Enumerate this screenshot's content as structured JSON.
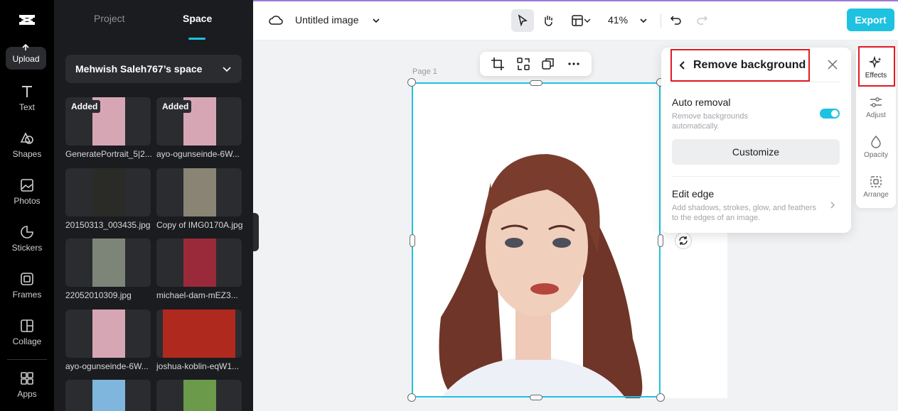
{
  "rail": {
    "items": [
      {
        "label": "Upload",
        "icon": "upload-icon"
      },
      {
        "label": "Text",
        "icon": "text-icon"
      },
      {
        "label": "Shapes",
        "icon": "shapes-icon"
      },
      {
        "label": "Photos",
        "icon": "photos-icon"
      },
      {
        "label": "Stickers",
        "icon": "stickers-icon"
      },
      {
        "label": "Frames",
        "icon": "frames-icon"
      },
      {
        "label": "Collage",
        "icon": "collage-icon"
      },
      {
        "label": "Apps",
        "icon": "apps-icon"
      }
    ]
  },
  "panel": {
    "tabs": [
      "Project",
      "Space"
    ],
    "active_tab": "Space",
    "space_name": "Mehwish Saleh767’s space",
    "assets": [
      {
        "name": "GeneratePortrait_5|2...",
        "badge": "Added",
        "color": "#d7a6b4"
      },
      {
        "name": "ayo-ogunseinde-6W...",
        "badge": "Added",
        "color": "#d7a6b4"
      },
      {
        "name": "20150313_003435.jpg",
        "badge": "",
        "color": "#2a2a26"
      },
      {
        "name": "Copy of IMG0170A.jpg",
        "badge": "",
        "color": "#8a8474"
      },
      {
        "name": "22052010309.jpg",
        "badge": "",
        "color": "#7d8578"
      },
      {
        "name": "michael-dam-mEZ3...",
        "badge": "",
        "color": "#9a2a3a"
      },
      {
        "name": "ayo-ogunseinde-6W...",
        "badge": "",
        "color": "#d7a6b4"
      },
      {
        "name": "joshua-koblin-eqW1...",
        "badge": "",
        "color": "#b0291f"
      },
      {
        "name": "",
        "badge": "",
        "color": "#7fb6dd"
      },
      {
        "name": "",
        "badge": "",
        "color": "#6b9a4a"
      }
    ]
  },
  "topbar": {
    "title": "Untitled image",
    "zoom": "41%",
    "export_label": "Export"
  },
  "canvas": {
    "page_label": "Page 1"
  },
  "remove_bg": {
    "title": "Remove background",
    "auto_title": "Auto removal",
    "auto_desc": "Remove backgrounds automatically.",
    "auto_enabled": true,
    "customize_label": "Customize",
    "edge_title": "Edit edge",
    "edge_desc": "Add shadows, strokes, glow, and feathers to the edges of an image."
  },
  "props": {
    "items": [
      {
        "label": "Effects",
        "icon": "effects-icon"
      },
      {
        "label": "Adjust",
        "icon": "adjust-icon"
      },
      {
        "label": "Opacity",
        "icon": "opacity-icon"
      },
      {
        "label": "Arrange",
        "icon": "arrange-icon"
      }
    ]
  },
  "colors": {
    "accent": "#1ec2e0",
    "highlight": "#e01b24"
  }
}
